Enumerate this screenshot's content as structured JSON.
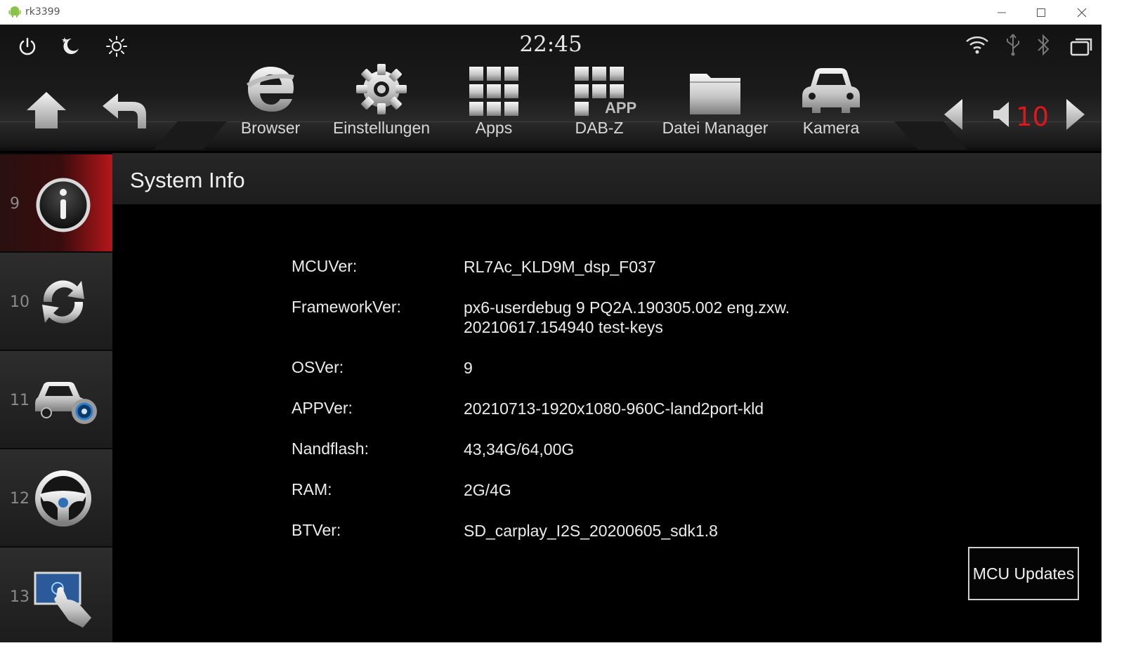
{
  "window": {
    "title": "rk3399"
  },
  "statusbar": {
    "time": "22:45",
    "volume": "10"
  },
  "apps": [
    {
      "label": "Browser",
      "icon": "browser-e-icon"
    },
    {
      "label": "Einstellungen",
      "icon": "gear-icon"
    },
    {
      "label": "Apps",
      "icon": "apps-grid-icon"
    },
    {
      "label": "DAB-Z",
      "icon": "app-grid-icon",
      "badge": "APP"
    },
    {
      "label": "Datei Manager",
      "icon": "folder-icon"
    },
    {
      "label": "Kamera",
      "icon": "car-icon"
    }
  ],
  "sidebar": {
    "items": [
      {
        "num": "9",
        "icon": "info-icon",
        "active": true
      },
      {
        "num": "10",
        "icon": "refresh-icon"
      },
      {
        "num": "11",
        "icon": "car-settings-icon"
      },
      {
        "num": "12",
        "icon": "steering-wheel-icon"
      },
      {
        "num": "13",
        "icon": "touch-screen-icon"
      }
    ]
  },
  "page": {
    "title": "System Info"
  },
  "info": [
    {
      "key": "MCUVer:",
      "value": "RL7Ac_KLD9M_dsp_F037"
    },
    {
      "key": "FrameworkVer:",
      "value": "px6-userdebug 9 PQ2A.190305.002 eng.zxw.",
      "value2": "20210617.154940 test-keys"
    },
    {
      "key": "OSVer:",
      "value": "9"
    },
    {
      "key": "APPVer:",
      "value": "20210713-1920x1080-960C-land2port-kld"
    },
    {
      "key": "Nandflash:",
      "value": "43,34G/64,00G"
    },
    {
      "key": "RAM:",
      "value": "2G/4G"
    },
    {
      "key": "BTVer:",
      "value": "SD_carplay_I2S_20200605_sdk1.8"
    }
  ],
  "actions": {
    "mcu_updates": "MCU Updates"
  },
  "colors": {
    "accent": "#e0161b",
    "background": "#000000"
  }
}
